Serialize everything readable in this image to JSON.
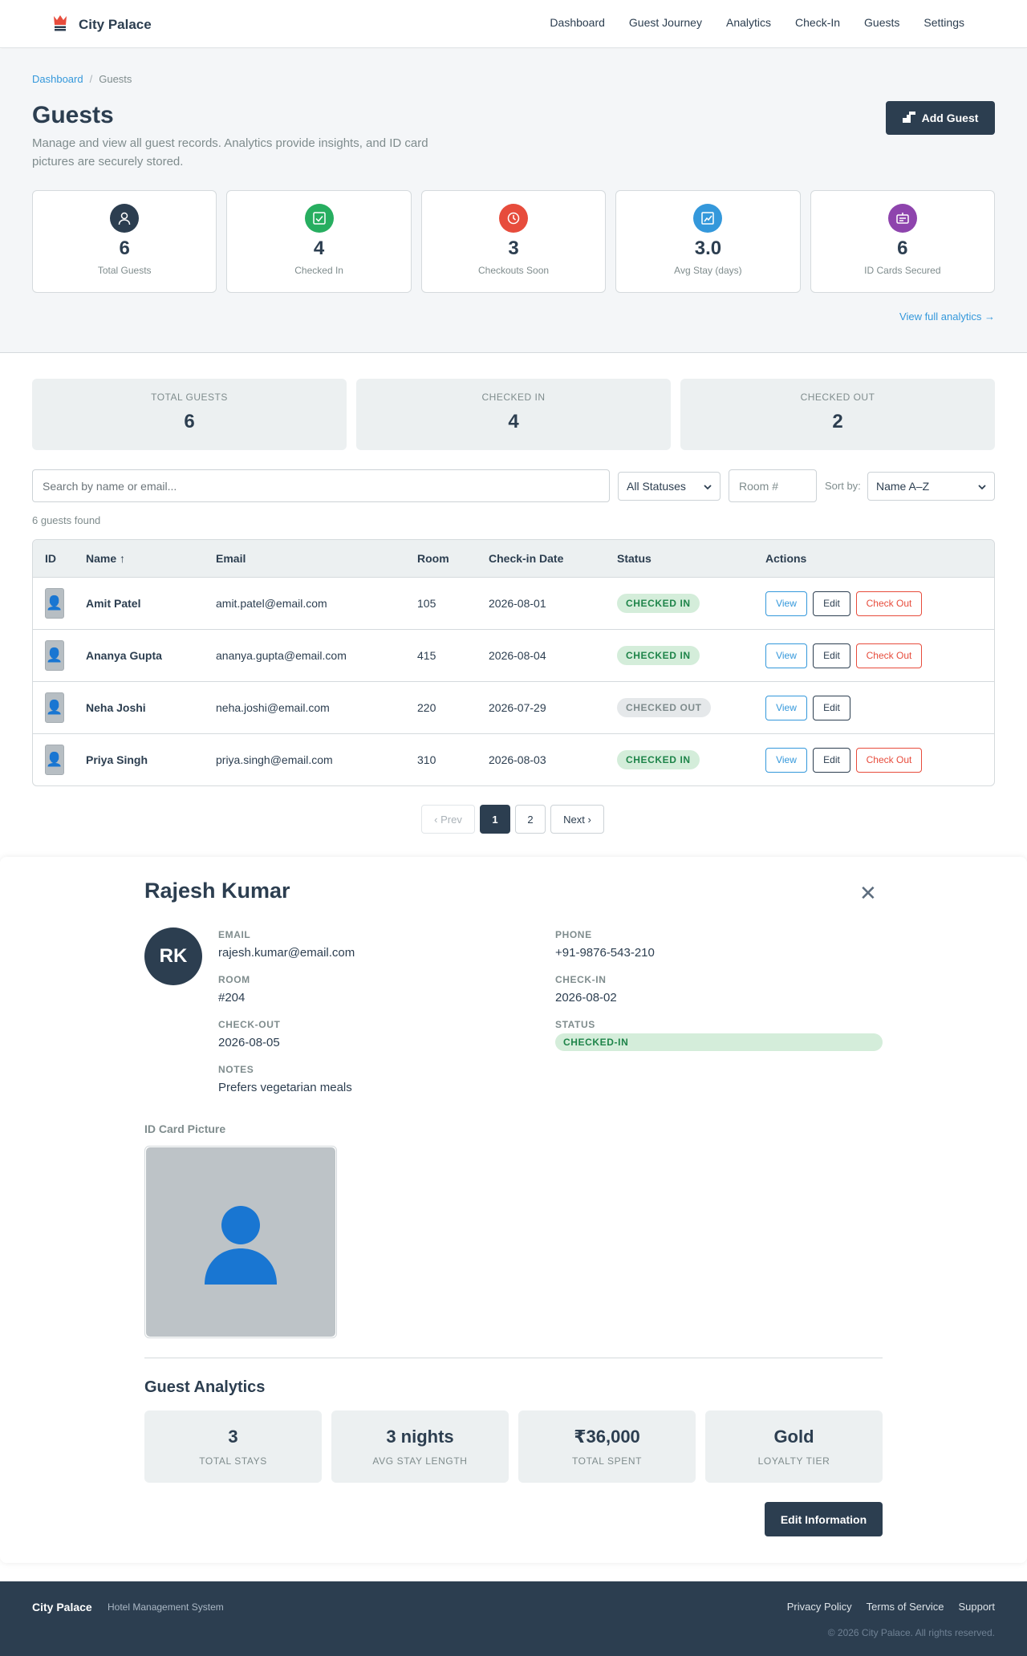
{
  "header": {
    "brand": "City Palace",
    "nav": [
      "Dashboard",
      "Guest Journey",
      "Analytics",
      "Check-In",
      "Guests",
      "Settings"
    ]
  },
  "breadcrumb": {
    "root": "Dashboard",
    "separator": "/",
    "current": "Guests"
  },
  "page": {
    "title": "Guests",
    "subtitle": "Manage and view all guest records. Analytics provide insights, and ID card pictures are securely stored.",
    "add_button": "Add Guest",
    "analytics_link": "View full analytics →"
  },
  "summary_cards": [
    {
      "value": "6",
      "label": "Total Guests",
      "icon": "user-icon",
      "color": "#2c3e50"
    },
    {
      "value": "4",
      "label": "Checked In",
      "icon": "check-square-icon",
      "color": "#27ae60"
    },
    {
      "value": "3",
      "label": "Checkouts Soon",
      "icon": "clock-icon",
      "color": "#e74c3c"
    },
    {
      "value": "3.0",
      "label": "Avg Stay (days)",
      "icon": "chart-icon",
      "color": "#3498db"
    },
    {
      "value": "6",
      "label": "ID Cards Secured",
      "icon": "id-card-icon",
      "color": "#8e44ad"
    }
  ],
  "stats": [
    {
      "label": "TOTAL GUESTS",
      "value": "6"
    },
    {
      "label": "CHECKED IN",
      "value": "4"
    },
    {
      "label": "CHECKED OUT",
      "value": "2"
    }
  ],
  "filters": {
    "search_placeholder": "Search by name or email...",
    "status_selected": "All Statuses",
    "room_placeholder": "Room #",
    "sort_label": "Sort by:",
    "sort_selected": "Name A–Z",
    "results_text": "6 guests found"
  },
  "table": {
    "columns": [
      "ID",
      "Name ↑",
      "Email",
      "Room",
      "Check-in Date",
      "Status",
      "Actions"
    ],
    "rows": [
      {
        "name": "Amit Patel",
        "email": "amit.patel@email.com",
        "room": "105",
        "date": "2026-08-01",
        "status": "CHECKED IN"
      },
      {
        "name": "Ananya Gupta",
        "email": "ananya.gupta@email.com",
        "room": "415",
        "date": "2026-08-04",
        "status": "CHECKED IN"
      },
      {
        "name": "Neha Joshi",
        "email": "neha.joshi@email.com",
        "room": "220",
        "date": "2026-07-29",
        "status": "CHECKED OUT"
      },
      {
        "name": "Priya Singh",
        "email": "priya.singh@email.com",
        "room": "310",
        "date": "2026-08-03",
        "status": "CHECKED IN"
      }
    ],
    "actions": {
      "view": "View",
      "edit": "Edit",
      "checkout": "Check Out"
    }
  },
  "pagination": {
    "prev": "‹ Prev",
    "pages": [
      "1",
      "2"
    ],
    "next": "Next ›",
    "current": "1"
  },
  "detail": {
    "name": "Rajesh Kumar",
    "close": "✕",
    "initials": "RK",
    "fields": {
      "email_label": "EMAIL",
      "email": "rajesh.kumar@email.com",
      "phone_label": "PHONE",
      "phone": "+91-9876-543-210",
      "room_label": "ROOM",
      "room": "#204",
      "checkin_label": "CHECK-IN",
      "checkin": "2026-08-02",
      "checkout_label": "CHECK-OUT",
      "checkout": "2026-08-05",
      "status_label": "STATUS",
      "status": "CHECKED-IN",
      "notes_label": "NOTES",
      "notes": "Prefers vegetarian meals"
    },
    "id_card_label": "ID Card Picture",
    "analytics_title": "Guest Analytics",
    "analytics": [
      {
        "value": "3",
        "label": "TOTAL STAYS"
      },
      {
        "value": "3 nights",
        "label": "AVG STAY LENGTH"
      },
      {
        "value": "₹36,000",
        "label": "TOTAL SPENT"
      },
      {
        "value": "Gold",
        "label": "LOYALTY TIER"
      }
    ],
    "edit_button": "Edit Information"
  },
  "footer": {
    "brand": "City Palace",
    "tagline": "Hotel Management System",
    "links": [
      "Privacy Policy",
      "Terms of Service",
      "Support"
    ],
    "copyright": "© 2026 City Palace. All rights reserved."
  }
}
